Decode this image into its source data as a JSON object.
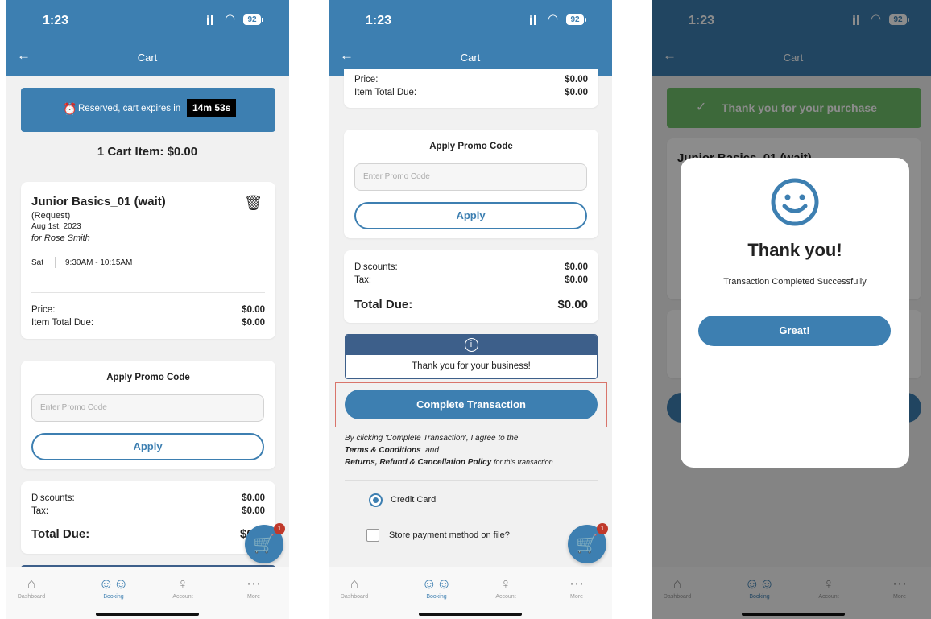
{
  "status": {
    "time": "1:23",
    "battery": "92"
  },
  "appbar": {
    "title": "Cart"
  },
  "tabs": [
    {
      "label": "Dashboard",
      "icon": "home-icon"
    },
    {
      "label": "Booking",
      "icon": "people-icon"
    },
    {
      "label": "Account",
      "icon": "person-icon"
    },
    {
      "label": "More",
      "icon": "more-icon"
    }
  ],
  "cart_badge": "1",
  "screen1": {
    "reserved_text": "Reserved, cart expires in",
    "timer": "14m 53s",
    "cart_summary": "1 Cart Item: $0.00",
    "item": {
      "name": "Junior Basics_01 (wait)",
      "type": "(Request)",
      "date": "Aug 1st, 2023",
      "for": "for Rose Smith",
      "day": "Sat",
      "time": "9:30AM - 10:15AM",
      "price_label": "Price:",
      "price": "$0.00",
      "item_total_label": "Item Total Due:",
      "item_total": "$0.00"
    },
    "promo": {
      "title": "Apply Promo Code",
      "placeholder": "Enter Promo Code",
      "apply": "Apply"
    },
    "totals": {
      "discounts_label": "Discounts:",
      "discounts": "$0.00",
      "tax_label": "Tax:",
      "tax": "$0.00",
      "total_label": "Total Due:",
      "total": "$0"
    }
  },
  "screen2": {
    "price_label": "Price:",
    "price": "$0.00",
    "item_total_label": "Item Total Due:",
    "item_total": "$0.00",
    "promo": {
      "title": "Apply Promo Code",
      "placeholder": "Enter Promo Code",
      "apply": "Apply"
    },
    "totals": {
      "discounts_label": "Discounts:",
      "discounts": "$0.00",
      "tax_label": "Tax:",
      "tax": "$0.00",
      "total_label": "Total Due:",
      "total": "$0.00"
    },
    "info_message": "Thank you for your business!",
    "complete_button": "Complete Transaction",
    "terms": {
      "intro": "By clicking 'Complete Transaction', I agree to the",
      "terms_link": "Terms & Conditions",
      "and": "and",
      "policy_link": "Returns, Refund & Cancellation Policy",
      "outro": "for this transaction."
    },
    "payment": {
      "credit_card": "Credit Card",
      "store_method": "Store payment method on file?"
    }
  },
  "screen3": {
    "banner": "Thank you for your purchase",
    "behind_item": "Junior Basics_01 (wait)",
    "modal": {
      "title": "Thank you!",
      "message": "Transaction Completed Successfully",
      "button": "Great!"
    }
  }
}
